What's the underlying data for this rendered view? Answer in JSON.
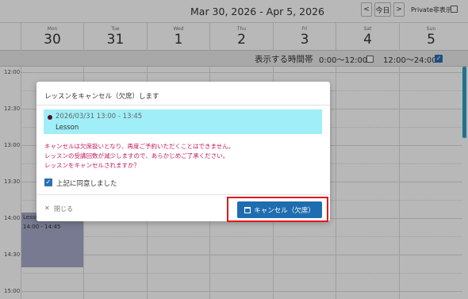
{
  "header": {
    "date_range": "Mar 30, 2026 - Apr 5, 2026",
    "prev_label": "<",
    "today_label": "今日",
    "next_label": ">",
    "private_label": "Private非表示"
  },
  "days": [
    {
      "name": "Mon",
      "date": "30"
    },
    {
      "name": "Tue",
      "date": "31"
    },
    {
      "name": "Wed",
      "date": "1"
    },
    {
      "name": "Thu",
      "date": "2"
    },
    {
      "name": "Fri",
      "date": "3"
    },
    {
      "name": "Sat",
      "date": "4"
    },
    {
      "name": "Sun",
      "date": "5"
    }
  ],
  "hours_bar": {
    "label": "表示する時間帯",
    "option_am": "0:00～12:00",
    "option_am_checked": false,
    "option_pm": "12:00～24:00",
    "option_pm_checked": true
  },
  "time_labels": [
    "12:00",
    "12:30",
    "13:00",
    "13:30",
    "14:00",
    "14:30",
    "15:00"
  ],
  "event": {
    "title": "Lesso",
    "time": "14:00 - 14:45"
  },
  "modal": {
    "title": "レッスンをキャンセル（欠席）します",
    "lesson_time": "2026/03/31 13:00 - 13:45",
    "lesson_name": "Lesson",
    "warning_lines": [
      "キャンセルは欠席扱いとなり、再度ご予約いただくことはできません。",
      "レッスンの受講回数が減少しますので、あらかじめご了承ください。",
      "レッスンをキャンセルされますか？"
    ],
    "agree_label": "上記に同意しました",
    "agree_checked": true,
    "close_label": "閉じる",
    "cancel_button": "キャンセル（欠席）"
  },
  "colors": {
    "primary": "#1e6db0",
    "warning_text": "#c2185b",
    "lesson_bg": "#a0eef7",
    "highlight": "#e0191e"
  }
}
